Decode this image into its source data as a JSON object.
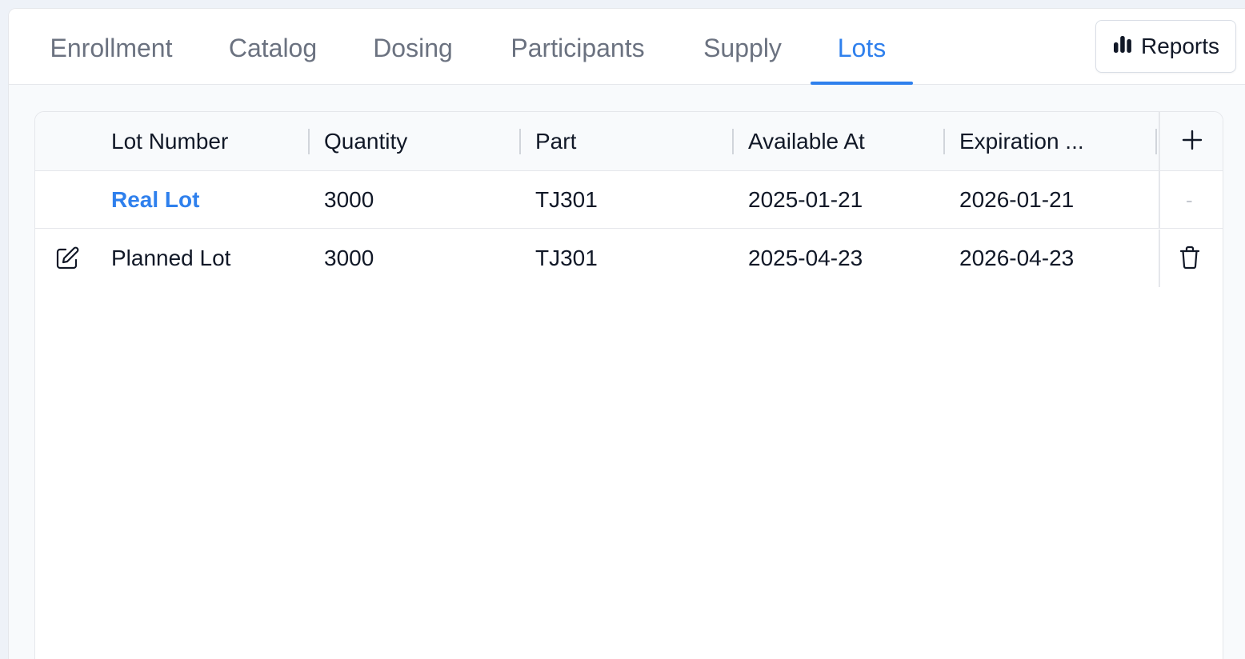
{
  "tabs": [
    {
      "label": "Enrollment",
      "active": false
    },
    {
      "label": "Catalog",
      "active": false
    },
    {
      "label": "Dosing",
      "active": false
    },
    {
      "label": "Participants",
      "active": false
    },
    {
      "label": "Supply",
      "active": false
    },
    {
      "label": "Lots",
      "active": true
    }
  ],
  "reports_button": {
    "label": "Reports",
    "icon": "bar-chart-icon"
  },
  "table": {
    "columns": [
      "Lot Number",
      "Quantity",
      "Part",
      "Available At",
      "Expiration ..."
    ],
    "add_icon": "plus-icon",
    "rows": [
      {
        "lot_number": "Real Lot",
        "quantity": "3000",
        "part": "TJ301",
        "available_at": "2025-01-21",
        "expiration": "2026-01-21",
        "action": "-",
        "editable": false
      },
      {
        "lot_number": "Planned Lot",
        "quantity": "3000",
        "part": "TJ301",
        "available_at": "2025-04-23",
        "expiration": "2026-04-23",
        "action": "trash-icon",
        "editable": true
      }
    ]
  },
  "colors": {
    "accent": "#2f80ed",
    "text": "#111827",
    "muted": "#6b7280",
    "border": "#e5e7eb"
  }
}
